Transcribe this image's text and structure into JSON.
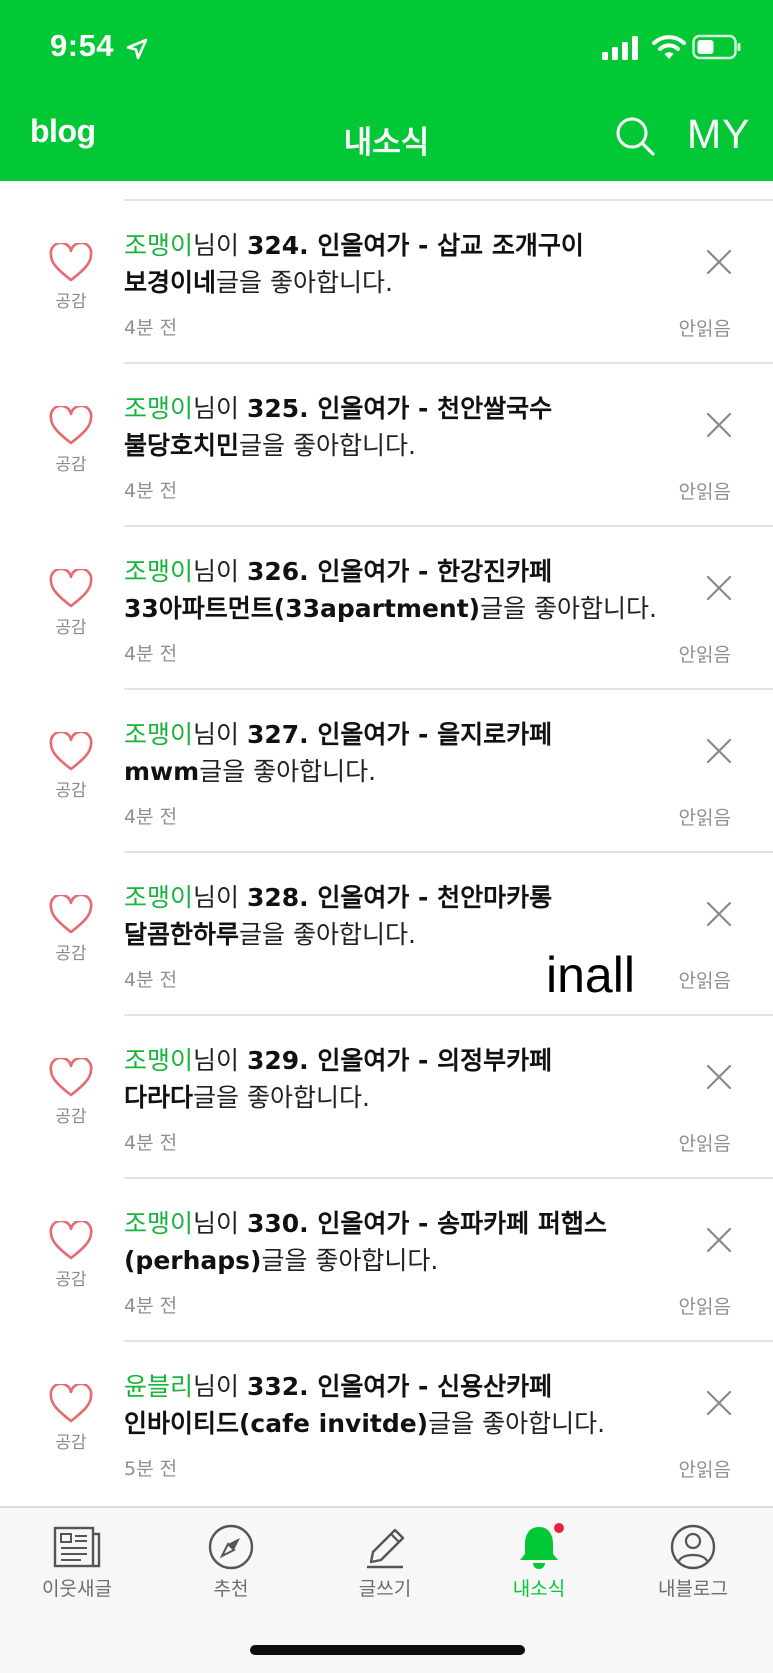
{
  "status_bar": {
    "time": "9:54"
  },
  "header": {
    "logo": "blog",
    "title": "내소식",
    "my_label": "MY"
  },
  "notifications": [
    {
      "user": "조맹이",
      "mid": "님이 ",
      "post": "324. 인올여가 - 삽교 조개구이 보경이네",
      "suffix": "글을 좋아합니다.",
      "time": "4분 전",
      "like_label": "공감",
      "status": "안읽음"
    },
    {
      "user": "조맹이",
      "mid": "님이 ",
      "post": "325. 인올여가 - 천안쌀국수 불당호치민",
      "suffix": "글을 좋아합니다.",
      "time": "4분 전",
      "like_label": "공감",
      "status": "안읽음"
    },
    {
      "user": "조맹이",
      "mid": "님이 ",
      "post": "326. 인올여가 - 한강진카페 33아파트먼트(33apartment)",
      "suffix": "글을 좋아합니다.",
      "time": "4분 전",
      "like_label": "공감",
      "status": "안읽음"
    },
    {
      "user": "조맹이",
      "mid": "님이 ",
      "post": "327. 인올여가 - 을지로카페 mwm",
      "suffix": "글을 좋아합니다.",
      "time": "4분 전",
      "like_label": "공감",
      "status": "안읽음"
    },
    {
      "user": "조맹이",
      "mid": "님이 ",
      "post": "328. 인올여가 - 천안마카롱 달콤한하루",
      "suffix": "글을 좋아합니다.",
      "time": "4분 전",
      "like_label": "공감",
      "status": "안읽음"
    },
    {
      "user": "조맹이",
      "mid": "님이 ",
      "post": "329. 인올여가 - 의정부카페 다라다",
      "suffix": "글을 좋아합니다.",
      "time": "4분 전",
      "like_label": "공감",
      "status": "안읽음"
    },
    {
      "user": "조맹이",
      "mid": "님이 ",
      "post": "330. 인올여가 - 송파카페 퍼햅스(perhaps)",
      "suffix": "글을 좋아합니다.",
      "time": "4분 전",
      "like_label": "공감",
      "status": "안읽음"
    },
    {
      "user": "윤블리",
      "mid": "님이 ",
      "post": "332. 인올여가 - 신용산카페 인바이티드(cafe invitde)",
      "suffix": "글을 좋아합니다.",
      "time": "5분 전",
      "like_label": "공감",
      "status": "안읽음"
    }
  ],
  "watermark": "inall",
  "tabs": [
    {
      "label": "이웃새글",
      "icon": "newspaper-icon",
      "active": false
    },
    {
      "label": "추천",
      "icon": "compass-icon",
      "active": false
    },
    {
      "label": "글쓰기",
      "icon": "pencil-icon",
      "active": false
    },
    {
      "label": "내소식",
      "icon": "bell-icon",
      "active": true
    },
    {
      "label": "내블로그",
      "icon": "profile-icon",
      "active": false
    }
  ],
  "colors": {
    "brand_green": "#03c836",
    "user_green": "#17b43c",
    "heart_red": "#e56b6f",
    "badge_red": "#e8213d"
  }
}
